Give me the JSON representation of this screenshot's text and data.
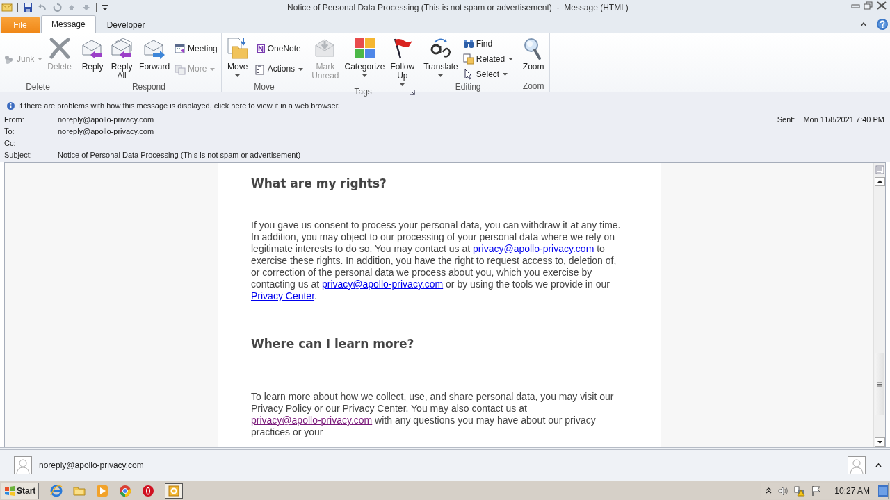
{
  "window": {
    "title": "Notice of Personal Data Processing (This is not spam or advertisement)  -  Message (HTML)"
  },
  "tabs": [
    {
      "label": "File",
      "kind": "file",
      "selected": false
    },
    {
      "label": "Message",
      "kind": "tab",
      "selected": true
    },
    {
      "label": "Developer",
      "kind": "tab",
      "selected": false
    }
  ],
  "ribbon": [
    {
      "label": "Delete",
      "launcher": false,
      "items": [
        {
          "label": "Junk",
          "kind": "small",
          "disabled": true,
          "dropdown": true
        },
        {
          "label": "Delete",
          "kind": "large",
          "disabled": true,
          "dropdown": false
        }
      ]
    },
    {
      "label": "Respond",
      "launcher": false,
      "items": [
        {
          "label": "Reply",
          "kind": "large",
          "disabled": false,
          "dropdown": false
        },
        {
          "label": "Reply\nAll",
          "kind": "large",
          "disabled": false,
          "dropdown": false
        },
        {
          "label": "Forward",
          "kind": "large",
          "disabled": false,
          "dropdown": false
        },
        {
          "label": "Meeting",
          "kind": "small",
          "disabled": false,
          "dropdown": false
        },
        {
          "label": "More",
          "kind": "small",
          "disabled": true,
          "dropdown": true
        }
      ]
    },
    {
      "label": "Move",
      "launcher": false,
      "items": [
        {
          "label": "Move",
          "kind": "large",
          "disabled": false,
          "dropdown": true
        },
        {
          "label": "OneNote",
          "kind": "small",
          "disabled": false,
          "dropdown": false
        },
        {
          "label": "Actions",
          "kind": "small",
          "disabled": false,
          "dropdown": true
        }
      ]
    },
    {
      "label": "Tags",
      "launcher": true,
      "items": [
        {
          "label": "Mark\nUnread",
          "kind": "large",
          "disabled": true,
          "dropdown": false
        },
        {
          "label": "Categorize",
          "kind": "large",
          "disabled": false,
          "dropdown": true
        },
        {
          "label": "Follow\nUp",
          "kind": "large",
          "disabled": false,
          "dropdown": true
        }
      ]
    },
    {
      "label": "Editing",
      "launcher": false,
      "items": [
        {
          "label": "Translate",
          "kind": "large",
          "disabled": false,
          "dropdown": true
        },
        {
          "label": "Find",
          "kind": "small",
          "disabled": false,
          "dropdown": false
        },
        {
          "label": "Related",
          "kind": "small",
          "disabled": false,
          "dropdown": true
        },
        {
          "label": "Select",
          "kind": "small",
          "disabled": false,
          "dropdown": true
        }
      ]
    },
    {
      "label": "Zoom",
      "launcher": false,
      "items": [
        {
          "label": "Zoom",
          "kind": "large",
          "disabled": false,
          "dropdown": false
        }
      ]
    }
  ],
  "info_bar": {
    "text": "If there are problems with how this message is displayed, click here to view it in a web browser."
  },
  "headers": [
    {
      "label": "From:",
      "value": "noreply@apollo-privacy.com"
    },
    {
      "label": "To:",
      "value": "noreply@apollo-privacy.com"
    },
    {
      "label": "Cc:"
    },
    {
      "label": "Subject:",
      "value": "Notice of Personal Data Processing (This is not spam or advertisement)"
    }
  ],
  "sent": {
    "label": "Sent:",
    "value": "Mon 11/8/2021 7:40 PM"
  },
  "body": [
    {
      "kind": "heading",
      "text": "What are my rights?"
    },
    {
      "kind": "paragraph",
      "parts": [
        {
          "text": "If you gave us consent to process your personal data, you can withdraw it at any time. In addition, you may object to our processing of your personal data where we rely on legitimate interests to do so. You may contact us at "
        },
        {
          "link": "privacy@apollo-privacy.com",
          "visited": false
        },
        {
          "text": " to exercise these rights. In addition, you have the right to request access to, deletion of, or correction of the personal data we process about you, which you exercise by contacting us at "
        },
        {
          "link": "privacy@apollo-privacy.com",
          "visited": false
        },
        {
          "text": " or by using the tools we provide in our "
        },
        {
          "link": "Privacy Center",
          "visited": false
        },
        {
          "text": "."
        }
      ]
    },
    {
      "kind": "heading",
      "text": "Where can I learn more?"
    },
    {
      "kind": "paragraph",
      "parts": [
        {
          "text": "To learn more about how we collect, use, and share personal data, you may visit our Privacy Policy or our Privacy Center. You may also contact us at "
        },
        {
          "link": "privacy@apollo-privacy.com",
          "visited": true
        },
        {
          "text": " with any questions you may have about our privacy practices or your"
        }
      ]
    }
  ],
  "people_pane": {
    "name": "noreply@apollo-privacy.com"
  },
  "taskbar": {
    "start": "Start",
    "clock": "10:27 AM"
  }
}
